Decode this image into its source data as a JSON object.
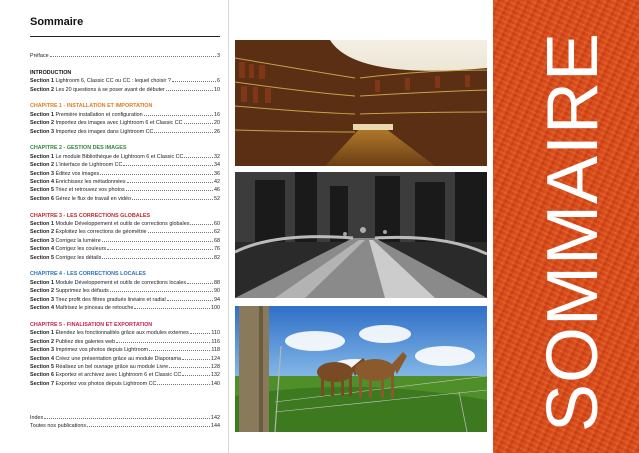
{
  "page_title": "Sommaire",
  "side_title": "SOMMAIRE",
  "preface": {
    "label": "Préface",
    "page": "3"
  },
  "sections": [
    {
      "heading": "INTRODUCTION",
      "color": "#111111",
      "entries": [
        {
          "num": "Section 1",
          "text": "Lightroom 6, Classic CC ou CC : lequel choisir ?",
          "page": "6"
        },
        {
          "num": "Section 2",
          "text": "Les 20 questions à se poser avant de débuter",
          "page": "10"
        }
      ]
    },
    {
      "heading": "CHAPITRE 1 - INSTALLATION ET IMPORTATION",
      "color": "#e07a1f",
      "entries": [
        {
          "num": "Section 1",
          "text": "Première installation et configuration",
          "page": "16"
        },
        {
          "num": "Section 2",
          "text": "Importez des images avec Lightroom 6 et Classic CC",
          "page": "20"
        },
        {
          "num": "Section 3",
          "text": "Importez des images dans Lightroom CC",
          "page": "26"
        }
      ]
    },
    {
      "heading": "CHAPITRE 2 - GESTION DES IMAGES",
      "color": "#2f8a3a",
      "entries": [
        {
          "num": "Section 1",
          "text": "Le module Bibliothèque de Lightroom 6 et Classic CC",
          "page": "32"
        },
        {
          "num": "Section 2",
          "text": "L'interface de Lightroom CC",
          "page": "34"
        },
        {
          "num": "Section 3",
          "text": "Éditez vos images",
          "page": "36"
        },
        {
          "num": "Section 4",
          "text": "Enrichissez les métadonnées",
          "page": "42"
        },
        {
          "num": "Section 5",
          "text": "Triez et retrouvez vos photos",
          "page": "46"
        },
        {
          "num": "Section 6",
          "text": "Gérez le flux de travail en vidéo",
          "page": "52"
        }
      ]
    },
    {
      "heading": "CHAPITRE 3 - LES CORRECTIONS GLOBALES",
      "color": "#c0282f",
      "entries": [
        {
          "num": "Section 1",
          "text": "Module Développement et outils de corrections globales",
          "page": "60"
        },
        {
          "num": "Section 2",
          "text": "Exploitez les corrections de géométrie",
          "page": "62"
        },
        {
          "num": "Section 3",
          "text": "Corrigez la lumière",
          "page": "68"
        },
        {
          "num": "Section 4",
          "text": "Corrigez les couleurs",
          "page": "76"
        },
        {
          "num": "Section 5",
          "text": "Corrigez les détails",
          "page": "82"
        }
      ]
    },
    {
      "heading": "CHAPITRE 4 - LES CORRECTIONS LOCALES",
      "color": "#2b72b4",
      "entries": [
        {
          "num": "Section 1",
          "text": "Module Développement et outils de corrections locales",
          "page": "88"
        },
        {
          "num": "Section 2",
          "text": "Supprimez les défauts",
          "page": "90"
        },
        {
          "num": "Section 3",
          "text": "Tirez profit des filtres gradués linéaire et radial",
          "page": "94"
        },
        {
          "num": "Section 4",
          "text": "Maîtrisez le pinceau de retouche",
          "page": "100"
        }
      ]
    },
    {
      "heading": "CHAPITRE 5 - FINALISATION ET EXPORTATION",
      "color": "#c81e4a",
      "entries": [
        {
          "num": "Section 1",
          "text": "Étendez les fonctionnalités grâce aux modules externes",
          "page": "110"
        },
        {
          "num": "Section 2",
          "text": "Publiez des galeries web",
          "page": "116"
        },
        {
          "num": "Section 3",
          "text": "Imprimez vos photos depuis Lightroom",
          "page": "118"
        },
        {
          "num": "Section 4",
          "text": "Créez une présentation grâce au module Diaporama",
          "page": "124"
        },
        {
          "num": "Section 5",
          "text": "Réalisez un bel ouvrage grâce au module Livre",
          "page": "128"
        },
        {
          "num": "Section 6",
          "text": "Exportez et archivez avec Lightroom 6 et Classic CC",
          "page": "132"
        },
        {
          "num": "Section 7",
          "text": "Exportez vos photos depuis Lightroom CC",
          "page": "140"
        }
      ]
    }
  ],
  "end_entries": [
    {
      "label": "Index",
      "page": "142"
    },
    {
      "label": "Toutes nos publications",
      "page": "144"
    }
  ]
}
